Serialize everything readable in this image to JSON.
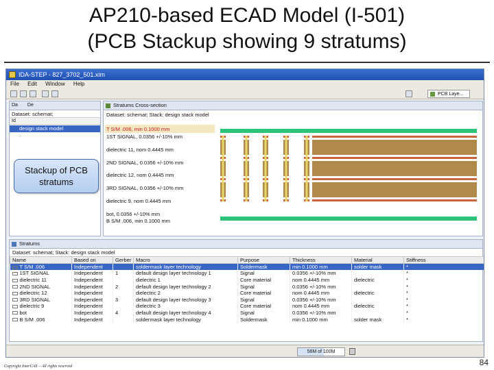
{
  "slide": {
    "title_line1": "AP210-based ECAD Model (I-501)",
    "title_line2": "(PCB Stackup showing 9 stratums)",
    "copyright": "Copyright InterCAX – All rights reserved",
    "page_number": "84"
  },
  "window": {
    "title": "IDA-STEP - 827_3702_501.xim",
    "menu": [
      "File",
      "Edit",
      "Window",
      "Help"
    ],
    "perspective_label": "PCB Laye..."
  },
  "left_view": {
    "tabs": [
      "Da",
      "De"
    ],
    "dataset": "Dataset: schemat;",
    "column": "Id",
    "selected_item": "design stack model"
  },
  "outline_popup": {
    "line1": "Stackup of PCB",
    "line2": "stratums"
  },
  "cross_section": {
    "tab_label": "Stratums Cross-section",
    "dataset": "Dataset: schemat; Stack: design stack model",
    "layers": [
      {
        "label": "T S/M .006, min 0.1000 mm",
        "kind": "mask"
      },
      {
        "label": "1ST SIGNAL, 0.0356 +/-10% mm",
        "kind": "copper"
      },
      {
        "label": "dielectric 11, nom 0.4445 mm",
        "kind": "dielectric"
      },
      {
        "label": "2ND SIGNAL, 0.0356 +/-10% mm",
        "kind": "copper"
      },
      {
        "label": "dielectric 12, nom 0.4445 mm",
        "kind": "dielectric"
      },
      {
        "label": "3RD SIGNAL, 0.0356 +/-10% mm",
        "kind": "copper"
      },
      {
        "label": "dielectric 9, nom 0.4445 mm",
        "kind": "dielectric"
      },
      {
        "label": "bot, 0.0356 +/-10% mm",
        "kind": "copper"
      },
      {
        "label": "B S/M .006, min 0.1000 mm",
        "kind": "mask"
      }
    ]
  },
  "stratums_table": {
    "tab_label": "Stratums",
    "dataset": "Dataset: schemat; Stack: design stack model",
    "columns": [
      "Name",
      "Based on",
      "Gerber",
      "Macro",
      "Purpose",
      "Thickness",
      "Material",
      "Stiffness"
    ],
    "rows": [
      {
        "name": "T S/M .006",
        "based_on": "Independent",
        "gerber": "",
        "macro": "soldermask layer technology",
        "purpose": "Soldermask",
        "thickness": "min 0.1000 mm",
        "material": "solder mask",
        "stiffness": "*"
      },
      {
        "name": "1ST SIGNAL",
        "based_on": "Independent",
        "gerber": "1",
        "macro": "default design layer technology 1",
        "purpose": "Signal",
        "thickness": "0.0356 +/-10% mm",
        "material": "",
        "stiffness": "*"
      },
      {
        "name": "dielectric 11",
        "based_on": "Independent",
        "gerber": "",
        "macro": "dielectric 1",
        "purpose": "Core material",
        "thickness": "nom 0.4445 mm",
        "material": "dielectric",
        "stiffness": "*"
      },
      {
        "name": "2ND SIGNAL",
        "based_on": "Independent",
        "gerber": "2",
        "macro": "default design layer technology 2",
        "purpose": "Signal",
        "thickness": "0.0356 +/-10% mm",
        "material": "",
        "stiffness": "*"
      },
      {
        "name": "dielectric 12",
        "based_on": "Independent",
        "gerber": "",
        "macro": "dielectric 2",
        "purpose": "Core material",
        "thickness": "nom 0.4445 mm",
        "material": "dielectric",
        "stiffness": "*"
      },
      {
        "name": "3RD SIGNAL",
        "based_on": "Independent",
        "gerber": "3",
        "macro": "default design layer technology 3",
        "purpose": "Signal",
        "thickness": "0.0356 +/-10% mm",
        "material": "",
        "stiffness": "*"
      },
      {
        "name": "dielectric 9",
        "based_on": "Independent",
        "gerber": "",
        "macro": "dielectric 3",
        "purpose": "Core material",
        "thickness": "nom 0.4445 mm",
        "material": "dielectric",
        "stiffness": "*"
      },
      {
        "name": "bot",
        "based_on": "Independent",
        "gerber": "4",
        "macro": "default design layer technology 4",
        "purpose": "Signal",
        "thickness": "0.0356 +/-10% mm",
        "material": "",
        "stiffness": "*"
      },
      {
        "name": "B S/M .006",
        "based_on": "Independent",
        "gerber": "",
        "macro": "soldermask layer technology",
        "purpose": "Soldermask",
        "thickness": "min 0.1000 mm",
        "material": "solder mask",
        "stiffness": "*"
      }
    ]
  },
  "status": {
    "memory": "56M of 100M",
    "memory_used_fraction": 0.56
  },
  "colors": {
    "mask": "#2ec47a",
    "copper": "#c8643a",
    "dielectric": "#b08a4a",
    "via_fill": "#e8d86a",
    "highlight": "#3866c4"
  }
}
